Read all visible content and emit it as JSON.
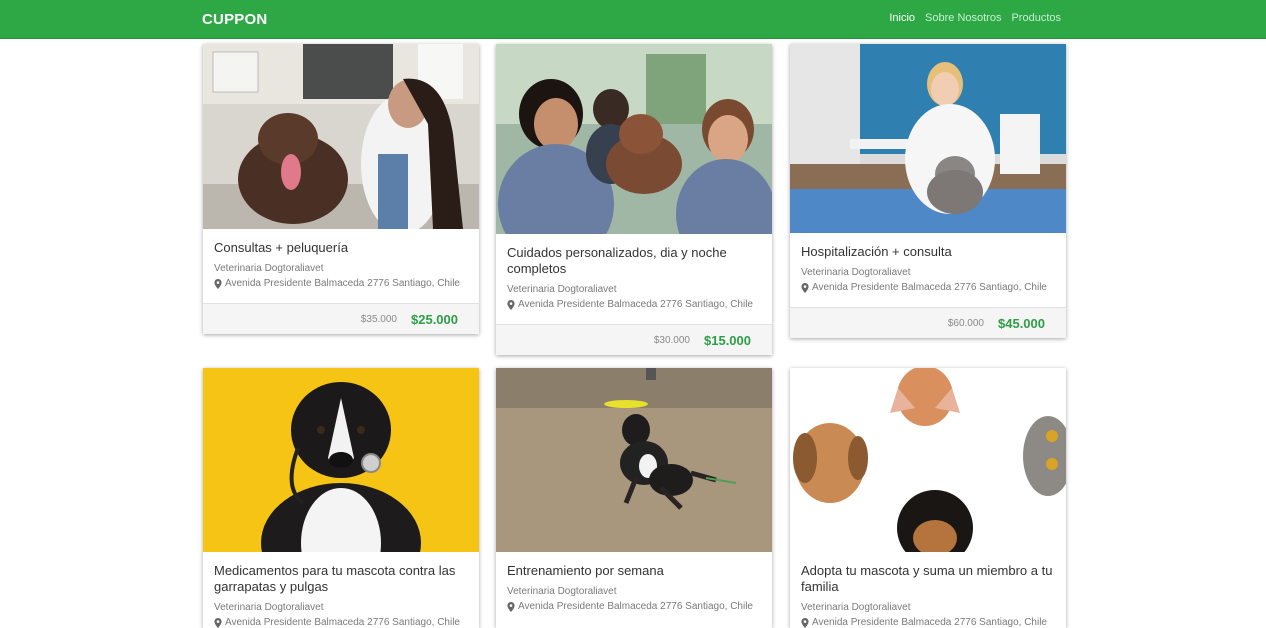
{
  "navbar": {
    "brand": "CUPPON",
    "links": [
      "Inicio",
      "Sobre Nosotros",
      "Productos"
    ],
    "active_link": "Inicio",
    "color": "#2ea844"
  },
  "cards": [
    {
      "title": "Consultas + peluquería",
      "business": "Veterinaria Dogtoraliavet",
      "address": "Avenida Presidente Balmaceda 2776 Santiago, Chile",
      "price_old": "$35.000",
      "price_new": "$25.000"
    },
    {
      "title": "Cuidados personalizados, dia y noche completos",
      "business": "Veterinaria Dogtoraliavet",
      "address": "Avenida Presidente Balmaceda 2776 Santiago, Chile",
      "price_old": "$30.000",
      "price_new": "$15.000"
    },
    {
      "title": "Hospitalización + consulta",
      "business": "Veterinaria Dogtoraliavet",
      "address": "Avenida Presidente Balmaceda 2776 Santiago, Chile",
      "price_old": "$60.000",
      "price_new": "$45.000"
    },
    {
      "title": "Medicamentos para tu mascota contra las garrapatas y pulgas",
      "business": "Veterinaria Dogtoraliavet",
      "address": "Avenida Presidente Balmaceda 2776 Santiago, Chile"
    },
    {
      "title": "Entrenamiento por semana",
      "business": "Veterinaria Dogtoraliavet",
      "address": "Avenida Presidente Balmaceda 2776 Santiago, Chile"
    },
    {
      "title": "Adopta tu mascota y suma un miembro a tu familia",
      "business": "Veterinaria Dogtoraliavet",
      "address": "Avenida Presidente Balmaceda 2776 Santiago, Chile"
    }
  ],
  "price_color": "#2e9e47"
}
